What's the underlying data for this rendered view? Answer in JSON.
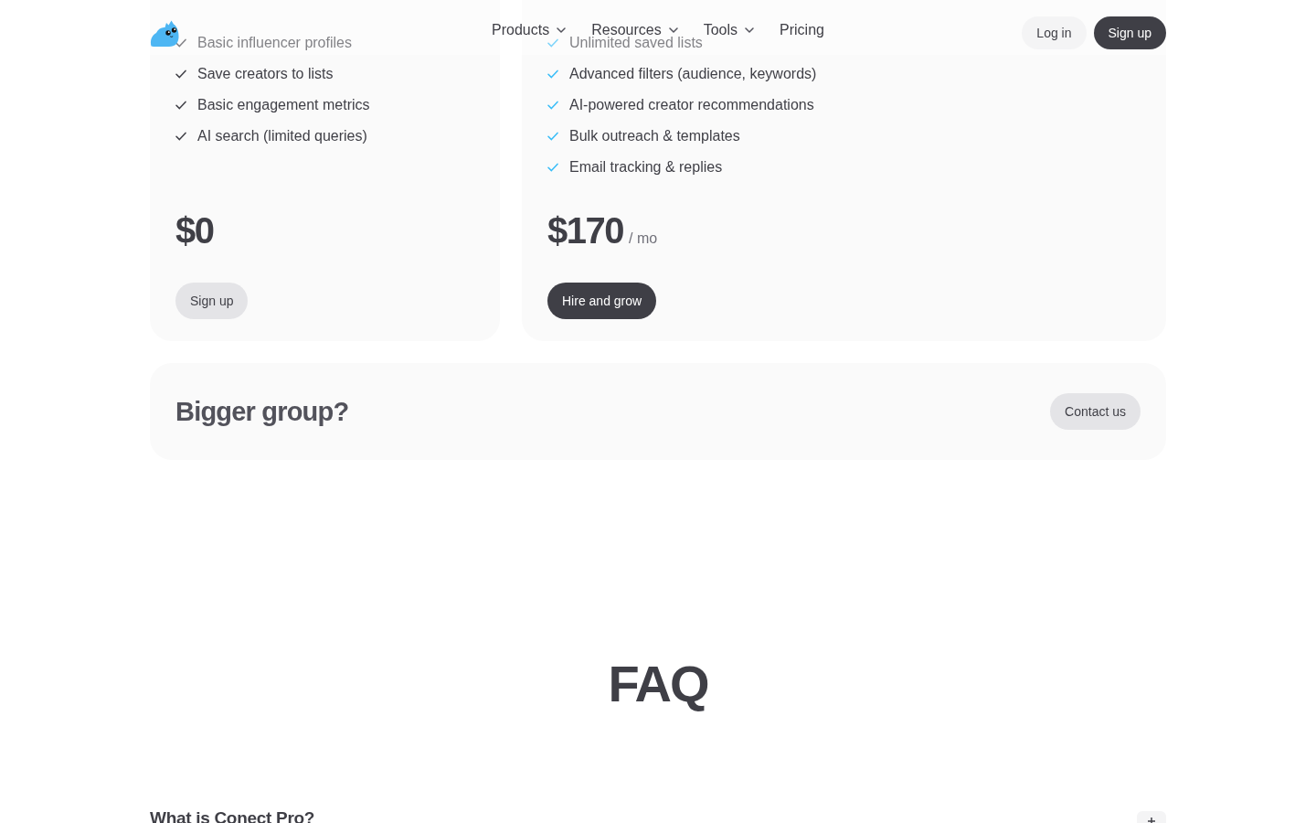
{
  "header": {
    "nav": [
      {
        "label": "Products",
        "has_menu": true
      },
      {
        "label": "Resources",
        "has_menu": true
      },
      {
        "label": "Tools",
        "has_menu": true
      },
      {
        "label": "Pricing",
        "has_menu": false
      }
    ],
    "actions": [
      {
        "label": "Log in",
        "kind": "secondary"
      },
      {
        "label": "Sign up",
        "kind": "primary"
      }
    ]
  },
  "plans": [
    {
      "featured": false,
      "features": [
        "Basic influencer profiles",
        "Save creators to lists",
        "Basic engagement metrics",
        "AI search (limited queries)"
      ],
      "price": "$0",
      "button": "Sign up"
    },
    {
      "featured": true,
      "features": [
        "Unlimited saved lists",
        "Advanced filters (audience, keywords)",
        "AI-powered creator recommendations",
        "Bulk outreach & templates",
        "Email tracking & replies"
      ],
      "price": "$170",
      "period": "/ mo",
      "button": "Hire and grow"
    }
  ],
  "group_card": {
    "title": "Bigger group?",
    "button": "Contact us"
  },
  "faq": {
    "title": "FAQ",
    "items": [
      {
        "question": "What is Conect Pro?"
      }
    ]
  }
}
